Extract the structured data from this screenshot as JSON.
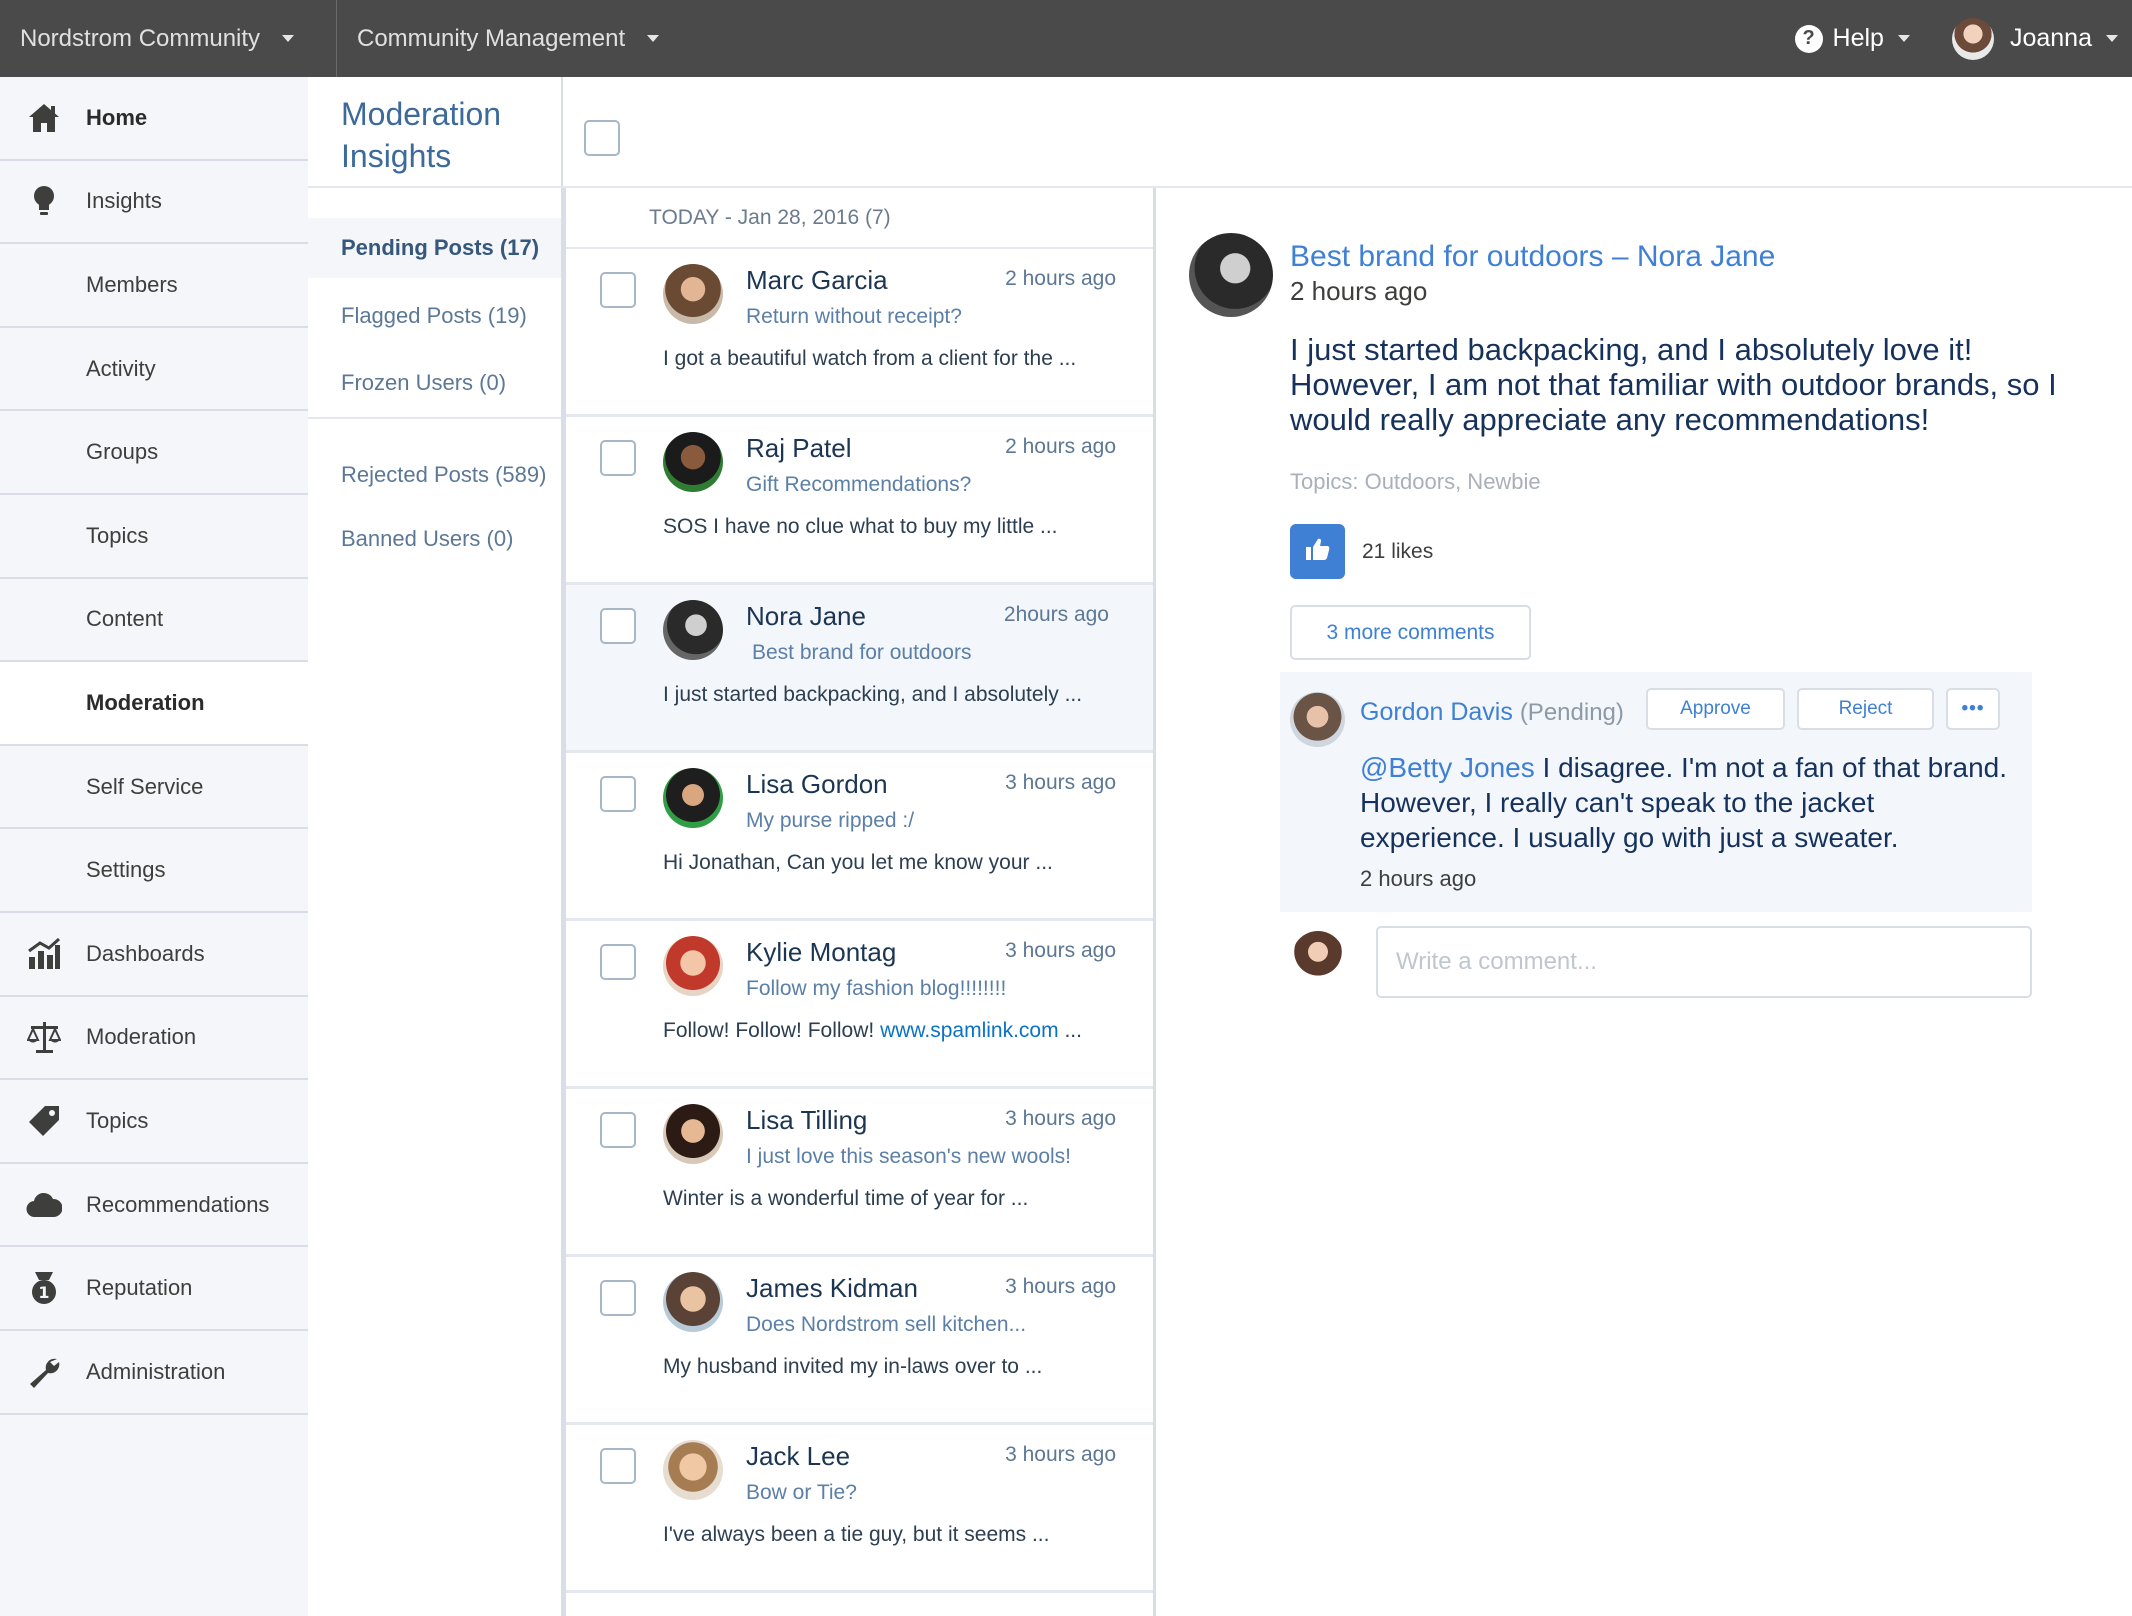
{
  "topbar": {
    "community": "Nordstrom Community",
    "section": "Community Management",
    "help": "Help",
    "user": "Joanna"
  },
  "sidebar": {
    "items": [
      {
        "label": "Home",
        "icon": "home-icon"
      },
      {
        "label": "Insights",
        "icon": "lightbulb-icon"
      },
      {
        "label": "Members"
      },
      {
        "label": "Activity"
      },
      {
        "label": "Groups"
      },
      {
        "label": "Topics"
      },
      {
        "label": "Content"
      },
      {
        "label": "Moderation"
      },
      {
        "label": "Self Service"
      },
      {
        "label": "Settings"
      },
      {
        "label": "Dashboards",
        "icon": "bar-chart-icon"
      },
      {
        "label": "Moderation",
        "icon": "scales-icon"
      },
      {
        "label": "Topics",
        "icon": "tag-icon"
      },
      {
        "label": "Recommendations",
        "icon": "cloud-icon"
      },
      {
        "label": "Reputation",
        "icon": "medal-icon"
      },
      {
        "label": "Administration",
        "icon": "wrench-icon"
      }
    ]
  },
  "moderation": {
    "title": "Moderation Insights",
    "filters": [
      "Pending Posts (17)",
      "Flagged Posts (19)",
      "Frozen Users (0)",
      "Rejected Posts (589)",
      "Banned Users (0)"
    ]
  },
  "posts": {
    "date_header": "TODAY - Jan 28, 2016 (7)",
    "items": [
      {
        "name": "Marc Garcia",
        "time": "2 hours ago",
        "subject": "Return without receipt?",
        "snippet": "I got a beautiful watch from a client for the ..."
      },
      {
        "name": "Raj Patel",
        "time": "2 hours ago",
        "subject": "Gift Recommendations?",
        "snippet": "SOS I have no clue what to buy my little ..."
      },
      {
        "name": "Nora Jane",
        "time": "2hours ago",
        "subject": "Best brand for outdoors",
        "snippet": "I just started backpacking, and I absolutely ..."
      },
      {
        "name": "Lisa Gordon",
        "time": "3 hours ago",
        "subject": "My purse ripped :/",
        "snippet": "Hi Jonathan, Can you let me know your ..."
      },
      {
        "name": "Kylie Montag",
        "time": "3 hours ago",
        "subject": "Follow my fashion blog!!!!!!!!",
        "snippet": "Follow! Follow! Follow! ",
        "link": "www.spamlink.com",
        "snippet_end": " ..."
      },
      {
        "name": "Lisa Tilling",
        "time": "3 hours ago",
        "subject": "I just love this season's new wools!",
        "snippet": "Winter is a wonderful time of year for ..."
      },
      {
        "name": "James Kidman",
        "time": "3 hours ago",
        "subject": "Does Nordstrom sell kitchen...",
        "snippet": "My husband invited my in-laws over to ..."
      },
      {
        "name": "Jack Lee",
        "time": "3 hours ago",
        "subject": "Bow or Tie?",
        "snippet": "I've always been a tie guy, but it seems ..."
      }
    ]
  },
  "detail": {
    "title": "Best brand for outdoors – Nora Jane",
    "time": "2 hours ago",
    "body": "I just started backpacking, and I absolutely love it! However, I am not that familiar with outdoor brands, so I would really appreciate any recommendations!",
    "topics": "Topics: Outdoors, Newbie",
    "likes": "21 likes",
    "more_comments": "3 more comments",
    "comment": {
      "author": "Gordon Davis",
      "status": "(Pending)",
      "approve": "Approve",
      "reject": "Reject",
      "more": "•••",
      "mention": "@Betty Jones",
      "text": " I disagree. I'm not a fan of that brand. However, I really can't speak to the jacket experience. I usually go with just a sweater.",
      "time": "2 hours ago"
    },
    "write_placeholder": "Write a comment..."
  },
  "colors": {
    "topbar": "#4a4a4a",
    "accent": "#3f80d4",
    "sidebar_bg": "#f4f6f9",
    "link": "#0b72c8"
  }
}
